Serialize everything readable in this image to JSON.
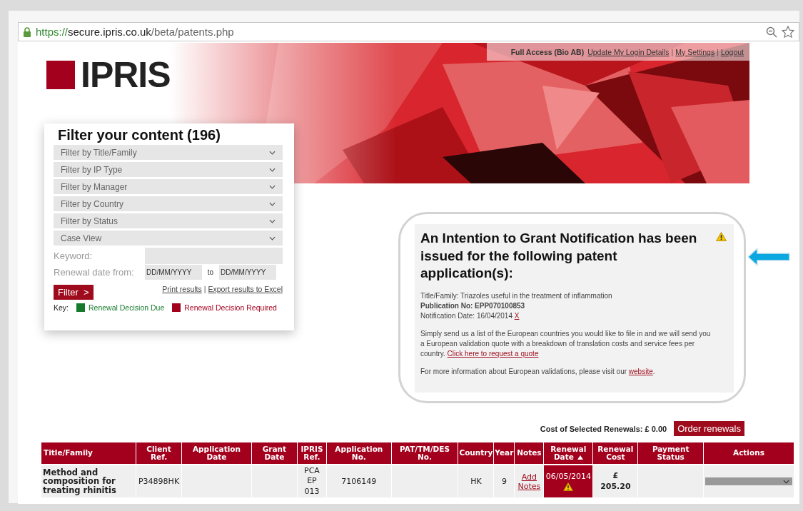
{
  "browser": {
    "url_scheme": "https://",
    "url_host": "secure.ipris.co.uk",
    "url_path": "/beta/patents.php"
  },
  "header": {
    "logo": "IPRIS",
    "account": "Full Access (Bio AB)",
    "separator": "|",
    "links": [
      "Update My Login Details",
      "My Settings",
      "Logout"
    ]
  },
  "filter": {
    "title": "Filter your content (196)",
    "dropdowns": [
      "Filter by Title/Family",
      "Filter by IP Type",
      "Filter by Manager",
      "Filter by Country",
      "Filter by Status",
      "Case View"
    ],
    "keyword_label": "Keyword:",
    "date_label": "Renewal date from:",
    "date_from_placeholder": "DD/MM/YYYY",
    "to_label": "to",
    "date_to_placeholder": "DD/MM/YYYY",
    "button": "Filter",
    "button_chevron": ">",
    "separator": "|",
    "links": [
      "Print results",
      "Export results to Excel"
    ],
    "key_label": "Key:",
    "key_items": [
      {
        "label": "Renewal Decision Due",
        "color": "#167a2c"
      },
      {
        "label": "Renewal Decision Required",
        "color": "#a3001e"
      }
    ]
  },
  "notification": {
    "title": "An Intention to Grant Notification has been issued for the following patent application(s):",
    "title_family": "Title/Family: Triazoles useful in the treatment of inflammation",
    "publication": "Publication No: EPP070100853",
    "notification_date": "Notification Date: 16/04/2014",
    "dismiss": "X",
    "body": "Simply send us a list of the European countries you would like to file in and we will send you a European validation quote with a breakdown of translation costs and service fees per country.",
    "quote_link": "Click here to request a quote",
    "more_info": "For more information about European validations, please visit our",
    "website_link": "website",
    "more_info_end": "."
  },
  "cost": {
    "label": "Cost of Selected Renewals: £ 0.00",
    "button": "Order renewals"
  },
  "table": {
    "columns": [
      {
        "label": "Title/Family",
        "sorted": false
      },
      {
        "label": "Client Ref.",
        "sorted": false
      },
      {
        "label": "Application Date",
        "sorted": false
      },
      {
        "label": "Grant Date",
        "sorted": false
      },
      {
        "label": "IPRIS Ref.",
        "sorted": false
      },
      {
        "label": "Application No.",
        "sorted": false
      },
      {
        "label": "PAT/TM/DES No.",
        "sorted": false
      },
      {
        "label": "Country",
        "sorted": false
      },
      {
        "label": "Year",
        "sorted": false
      },
      {
        "label": "Notes",
        "sorted": false
      },
      {
        "label": "Renewal Date",
        "sorted": true
      },
      {
        "label": "Renewal Cost",
        "sorted": false
      },
      {
        "label": "Payment Status",
        "sorted": false
      },
      {
        "label": "Actions",
        "sorted": false
      }
    ],
    "rows": [
      {
        "title": "Method and composition for treating rhinitis",
        "client_ref": "P34898HK",
        "ipris_ref": "PCA EP 013",
        "application_no": "7106149",
        "country": "HK",
        "year": "9",
        "notes_link": "Add Notes",
        "renewal_date": "06/05/2014",
        "decision_required": true,
        "warning": true,
        "renewal_cost": "£ 205.20"
      }
    ]
  }
}
